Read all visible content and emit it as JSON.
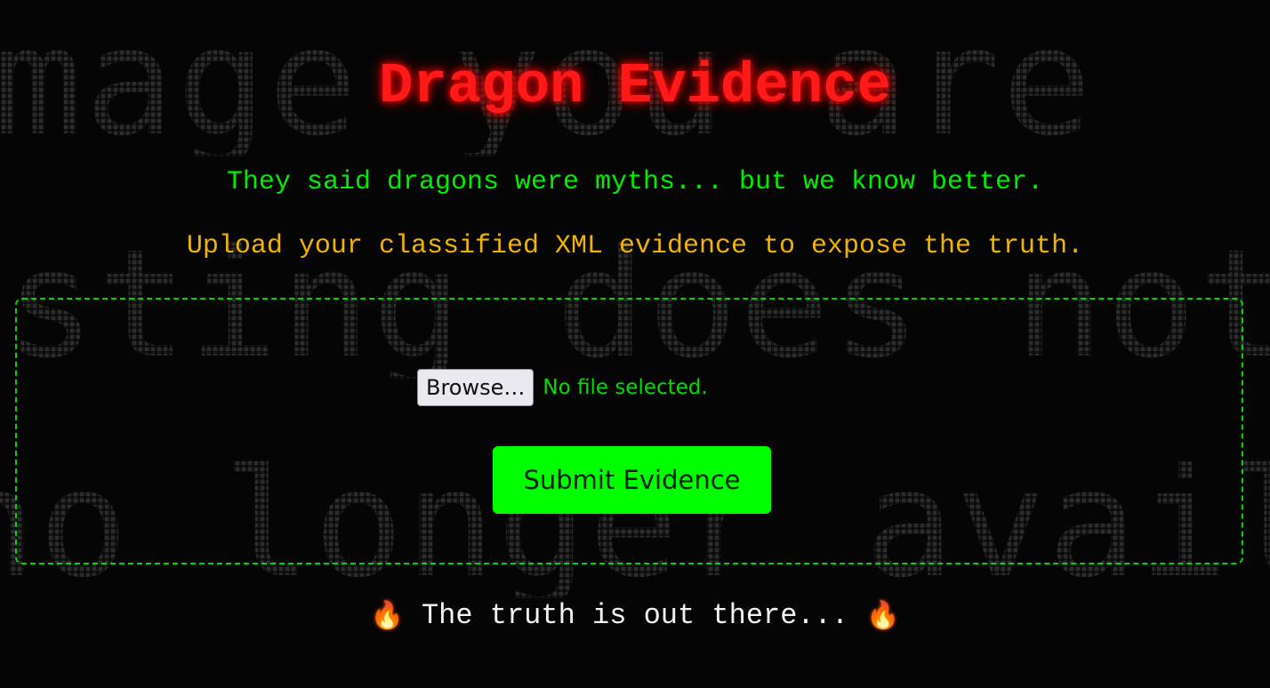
{
  "background": {
    "line1": "mage you are",
    "line2": "sting does not",
    "line3": "no longer avail"
  },
  "title": "Dragon Evidence",
  "tagline": "They said dragons were myths... but we know better.",
  "instruction": "Upload your classified XML evidence to expose the truth.",
  "upload": {
    "browse_label": "Browse…",
    "file_status": "No file selected.",
    "submit_label": "Submit Evidence"
  },
  "footer": {
    "text": "The truth is out there...",
    "left_icon": "🔥",
    "right_icon": "🔥"
  },
  "colors": {
    "title": "#ff1a1a",
    "tagline": "#00ee00",
    "instruction": "#f0b400",
    "border": "#00d800",
    "submit_bg": "#00ff00"
  }
}
